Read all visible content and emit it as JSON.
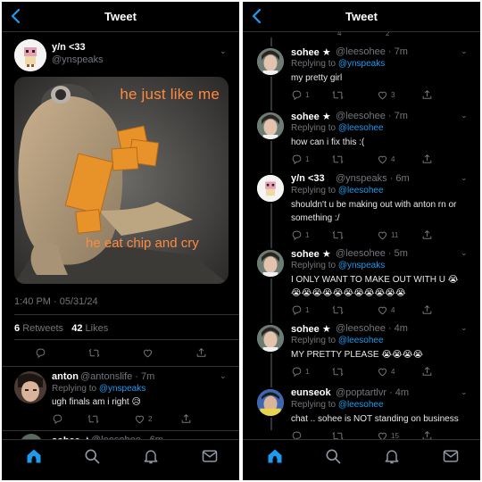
{
  "left": {
    "title": "Tweet",
    "main": {
      "name": "y/n <33",
      "handle": "@ynspeaks",
      "meme_top": "he just like me",
      "meme_bottom": "he eat chip and cry",
      "timestamp": "1:40 PM · 05/31/24",
      "retweets_count": "6",
      "retweets_label": "Retweets",
      "likes_count": "42",
      "likes_label": "Likes"
    },
    "reply": {
      "name": "anton",
      "handle": "@antonslife · 7m",
      "replying_label": "Replying to",
      "replying_to": "@ynspeaks",
      "text": "ugh finals am i right 😥",
      "likes": "2"
    },
    "next": {
      "name": "sohee ★",
      "handle": "@leesohee · 6m"
    }
  },
  "right": {
    "title": "Tweet",
    "replying_label": "Replying to",
    "tweets": [
      {
        "name": "sohee ★",
        "handle": "@leesohee · 7m",
        "to": "@ynspeaks",
        "lines": [
          "my pretty girl"
        ],
        "replies": "1",
        "retweets": "",
        "likes": "3"
      },
      {
        "name": "sohee ★",
        "handle": "@leesohee · 7m",
        "to": "@leesohee",
        "lines": [
          "how can i fix this :("
        ],
        "replies": "1",
        "retweets": "",
        "likes": "4"
      },
      {
        "name": "y/n <33",
        "handle": "@ynspeaks · 6m",
        "to": "@leesohee",
        "lines": [
          "shouldn't u be making out with anton rn or",
          "something :/"
        ],
        "replies": "1",
        "retweets": "",
        "likes": "11"
      },
      {
        "name": "sohee ★",
        "handle": "@leesohee · 5m",
        "to": "@ynspeaks",
        "lines": [
          "I ONLY WANT TO MAKE OUT WITH U 😭",
          "😭😭😭😭😭😭😭😭😭😭😭"
        ],
        "replies": "1",
        "retweets": "",
        "likes": "4"
      },
      {
        "name": "sohee ★",
        "handle": "@leesohee · 4m",
        "to": "@leesohee",
        "lines": [
          "MY PRETTY PLEASE 😭😭😭😭"
        ],
        "replies": "1",
        "retweets": "",
        "likes": "4"
      },
      {
        "name": "eunseok",
        "handle": "@poptartlvr · 4m",
        "to": "@leesohee",
        "lines": [
          "chat .. sohee is NOT standing on business"
        ],
        "replies": "",
        "retweets": "",
        "likes": "15"
      }
    ],
    "cut_top": {
      "retweets": "4",
      "likes": "2"
    }
  },
  "icons": {
    "back": "chevron-left-icon",
    "home": "home-icon",
    "search": "search-icon",
    "notifications": "bell-icon",
    "messages": "mail-icon",
    "reply": "reply-icon",
    "retweet": "retweet-icon",
    "like": "heart-icon",
    "share": "share-icon",
    "more": "chevron-down-icon"
  },
  "colors": {
    "accent": "#1d9bf0",
    "background": "#000000",
    "muted": "#71767b",
    "meme_text": "#ff8a3d"
  }
}
